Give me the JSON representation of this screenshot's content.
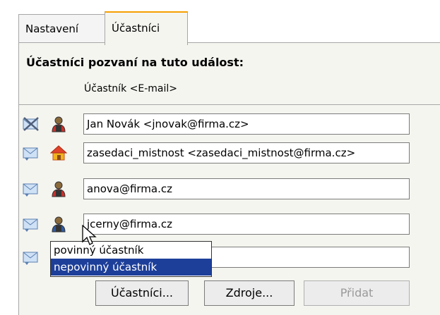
{
  "tabs": [
    {
      "label": "Nastavení",
      "active": false
    },
    {
      "label": "Účastníci",
      "active": true
    }
  ],
  "section_title": "Účastníci pozvaní na tuto událost:",
  "column_header": "Účastník <E-mail>",
  "attendees": [
    {
      "value": "Jan Novák <jnovak@firma.cz>",
      "type_icon": "person-icon",
      "mail_icon": "mail-crossed-icon"
    },
    {
      "value": "zasedaci_mistnost <zasedaci_mistnost@firma.cz>",
      "type_icon": "house-icon",
      "mail_icon": "mail-icon"
    },
    {
      "value": "anova@firma.cz",
      "type_icon": "person-icon",
      "mail_icon": "mail-icon"
    },
    {
      "value": "jcerny@firma.cz",
      "type_icon": "person-icon",
      "mail_icon": "mail-icon"
    },
    {
      "value": "",
      "mail_icon": "mail-icon"
    }
  ],
  "role_dropdown": {
    "options": [
      "povinný účastník",
      "nepovinný účastník"
    ],
    "selected": "nepovinný účastník"
  },
  "buttons": {
    "attendees": "Účastníci...",
    "resources": "Zdroje...",
    "add": "Přidat"
  },
  "colors": {
    "active_tab_accent": "#f5a000",
    "selection": "#1d3f9a",
    "panel_bg": "#f5f5f0"
  }
}
